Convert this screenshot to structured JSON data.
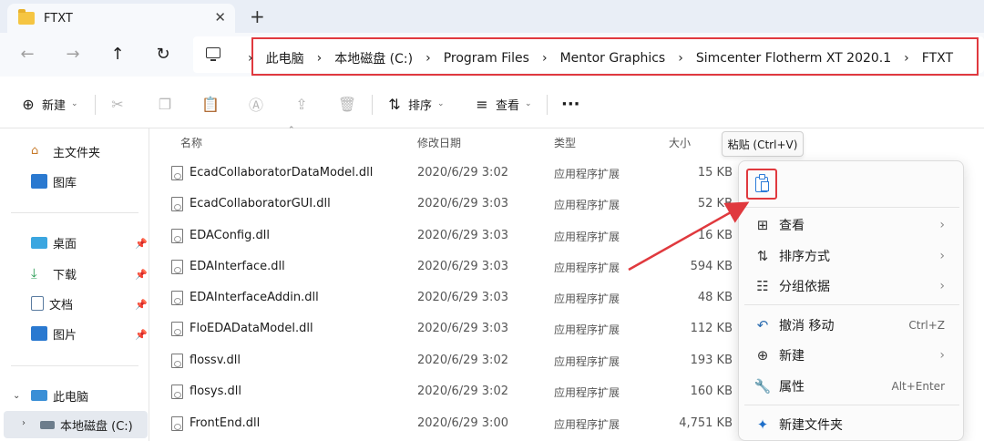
{
  "window": {
    "tab_title": "FTXT",
    "tab_close": "✕",
    "new_tab": "+"
  },
  "nav": {
    "back": "←",
    "forward": "→",
    "up": "↑",
    "refresh": "↻"
  },
  "breadcrumb": {
    "separator": "›",
    "items": [
      "此电脑",
      "本地磁盘 (C:)",
      "Program Files",
      "Mentor Graphics",
      "Simcenter Flotherm XT 2020.1",
      "FTXT"
    ]
  },
  "toolbar": {
    "new_label": "新建",
    "sort_label": "排序",
    "view_label": "查看",
    "more_label": "···"
  },
  "sidebar": {
    "home": "主文件夹",
    "gallery": "图库",
    "desktop": "桌面",
    "downloads": "下载",
    "documents": "文档",
    "pictures": "图片",
    "this_pc": "此电脑",
    "local_disk": "本地磁盘 (C:)"
  },
  "columns": {
    "name": "名称",
    "modified": "修改日期",
    "type": "类型",
    "size": "大小"
  },
  "files": [
    {
      "name": "EcadCollaboratorDataModel.dll",
      "date": "2020/6/29 3:02",
      "type": "应用程序扩展",
      "size": "15 KB"
    },
    {
      "name": "EcadCollaboratorGUI.dll",
      "date": "2020/6/29 3:03",
      "type": "应用程序扩展",
      "size": "52 KB"
    },
    {
      "name": "EDAConfig.dll",
      "date": "2020/6/29 3:03",
      "type": "应用程序扩展",
      "size": "16 KB"
    },
    {
      "name": "EDAInterface.dll",
      "date": "2020/6/29 3:03",
      "type": "应用程序扩展",
      "size": "594 KB"
    },
    {
      "name": "EDAInterfaceAddin.dll",
      "date": "2020/6/29 3:03",
      "type": "应用程序扩展",
      "size": "48 KB"
    },
    {
      "name": "FloEDADataModel.dll",
      "date": "2020/6/29 3:03",
      "type": "应用程序扩展",
      "size": "112 KB"
    },
    {
      "name": "flossv.dll",
      "date": "2020/6/29 3:02",
      "type": "应用程序扩展",
      "size": "193 KB"
    },
    {
      "name": "flosys.dll",
      "date": "2020/6/29 3:02",
      "type": "应用程序扩展",
      "size": "160 KB"
    },
    {
      "name": "FrontEnd.dll",
      "date": "2020/6/29 3:00",
      "type": "应用程序扩展",
      "size": "4,751 KB"
    }
  ],
  "tooltip": "粘贴 (Ctrl+V)",
  "context_menu": {
    "view": "查看",
    "sort": "排序方式",
    "group": "分组依据",
    "undo": "撤消 移动",
    "undo_shortcut": "Ctrl+Z",
    "new": "新建",
    "properties": "属性",
    "properties_shortcut": "Alt+Enter",
    "new_folder": "新建文件夹",
    "submenu_arrow": "›"
  },
  "colors": {
    "highlight_red": "#e0393e",
    "accent_blue": "#2b6cb0"
  }
}
